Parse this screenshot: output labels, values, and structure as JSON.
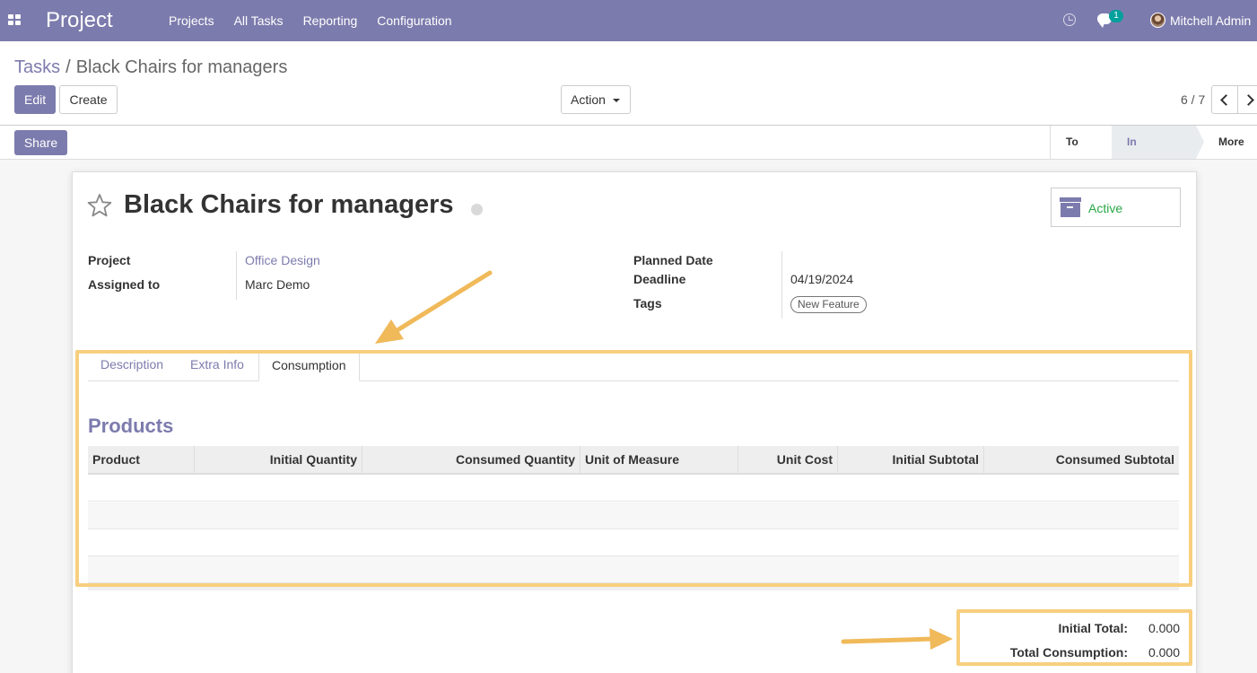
{
  "navbar": {
    "brand": "Project",
    "menu": [
      "Projects",
      "All Tasks",
      "Reporting",
      "Configuration"
    ],
    "messages_count": "1",
    "user_name": "Mitchell Admin"
  },
  "breadcrumb": {
    "parent": "Tasks",
    "separator": "/",
    "current": "Black Chairs for managers"
  },
  "buttons": {
    "edit": "Edit",
    "create": "Create",
    "action": "Action",
    "share": "Share"
  },
  "pager": {
    "value": "6 / 7"
  },
  "stages": {
    "todo": "To Do",
    "in_progress": "In Progress",
    "more": "More"
  },
  "task": {
    "title": "Black Chairs for managers",
    "active_label": "Active",
    "project_label": "Project",
    "project_value": "Office Design",
    "assigned_label": "Assigned to",
    "assigned_value": "Marc Demo",
    "planned_date_label": "Planned Date",
    "deadline_label": "Deadline",
    "deadline_value": "04/19/2024",
    "tags_label": "Tags",
    "tag_value": "New Feature"
  },
  "tabs": [
    "Description",
    "Extra Info",
    "Consumption"
  ],
  "products": {
    "title": "Products",
    "columns": [
      "Product",
      "Initial Quantity",
      "Consumed Quantity",
      "Unit of Measure",
      "Unit Cost",
      "Initial Subtotal",
      "Consumed Subtotal"
    ]
  },
  "totals": {
    "initial_label": "Initial Total:",
    "initial_value": "0.000",
    "consumption_label": "Total Consumption:",
    "consumption_value": "0.000"
  },
  "colors": {
    "brand": "#7c7bad",
    "active": "#28a745",
    "highlight": "#f7cf7f",
    "arrow": "#f0b95a"
  }
}
